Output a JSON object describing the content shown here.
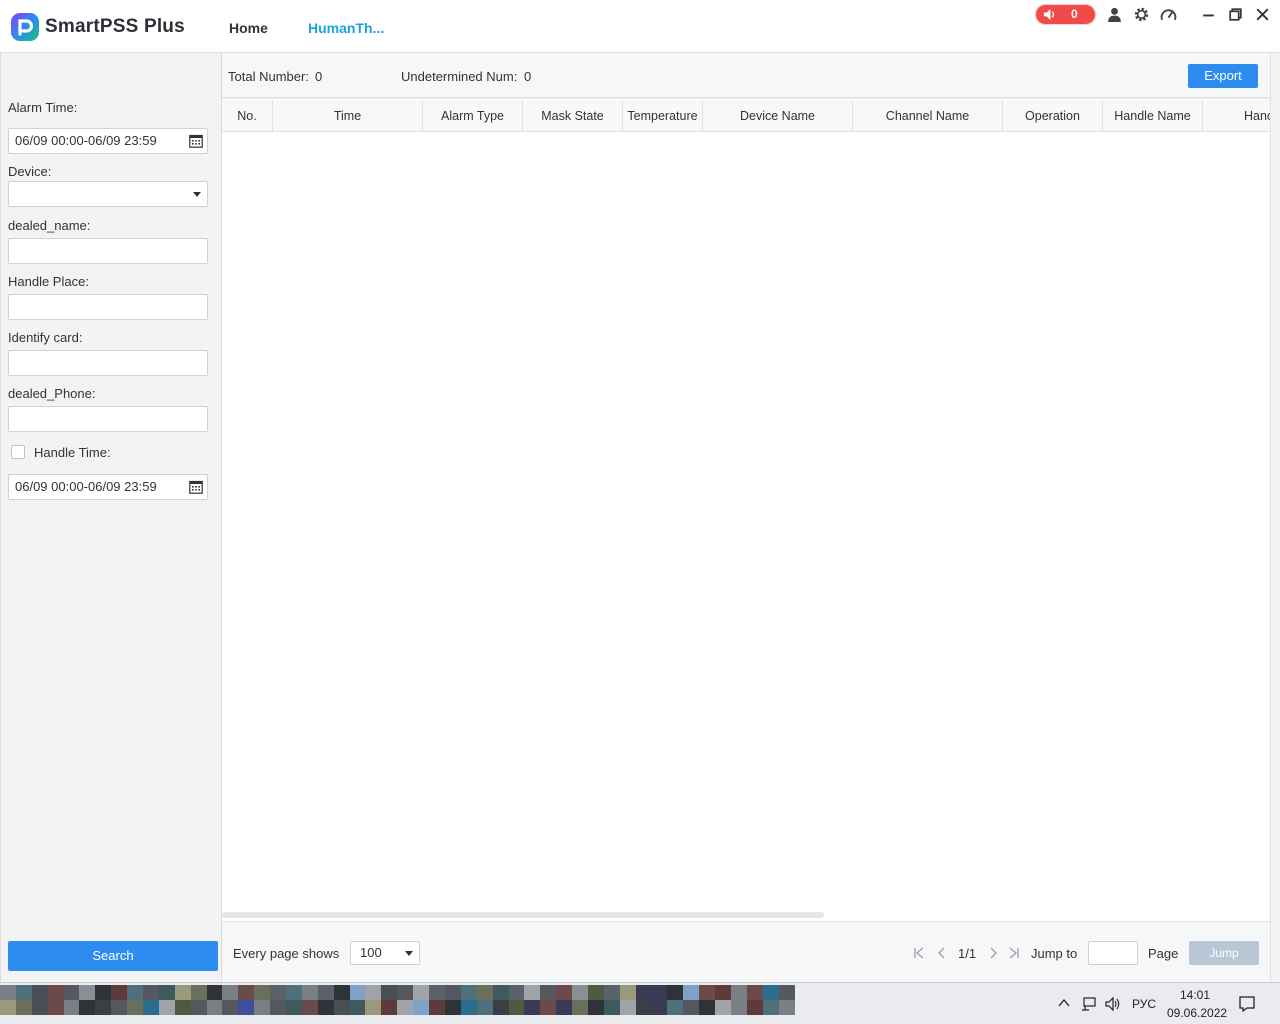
{
  "app": {
    "title": "SmartPSS Plus",
    "nav_home": "Home",
    "nav_active_tab": "HumanTh...",
    "alarm_count": "0",
    "accent": "#2d8cf0",
    "tab_color": "#1ba1e2",
    "alarm_color": "#ef4b4b"
  },
  "filters": {
    "alarm_time_label": "Alarm Time:",
    "alarm_time_value": "06/09 00:00-06/09 23:59",
    "device_label": "Device:",
    "device_value": "",
    "dealed_name_label": "dealed_name:",
    "handle_place_label": "Handle Place:",
    "identify_card_label": "Identify card:",
    "dealed_phone_label": "dealed_Phone:",
    "handle_time_label": "Handle Time:",
    "handle_time_value": "06/09 00:00-06/09 23:59",
    "search_label": "Search"
  },
  "summary": {
    "total_label": "Total Number:",
    "total_value": "0",
    "undetermined_label": "Undetermined Num:",
    "undetermined_value": "0",
    "export_label": "Export"
  },
  "table": {
    "columns": [
      "No.",
      "Time",
      "Alarm Type",
      "Mask State",
      "Temperature",
      "Device Name",
      "Channel Name",
      "Operation",
      "Handle Name",
      "Hanc"
    ],
    "rows": []
  },
  "pager": {
    "every_page_label": "Every page shows",
    "page_size": "100",
    "page_indicator": "1/1",
    "jump_to_label": "Jump to",
    "page_label": "Page",
    "jump_button": "Jump"
  },
  "taskbar": {
    "language": "РУС",
    "time": "14:01",
    "date": "09.06.2022"
  }
}
